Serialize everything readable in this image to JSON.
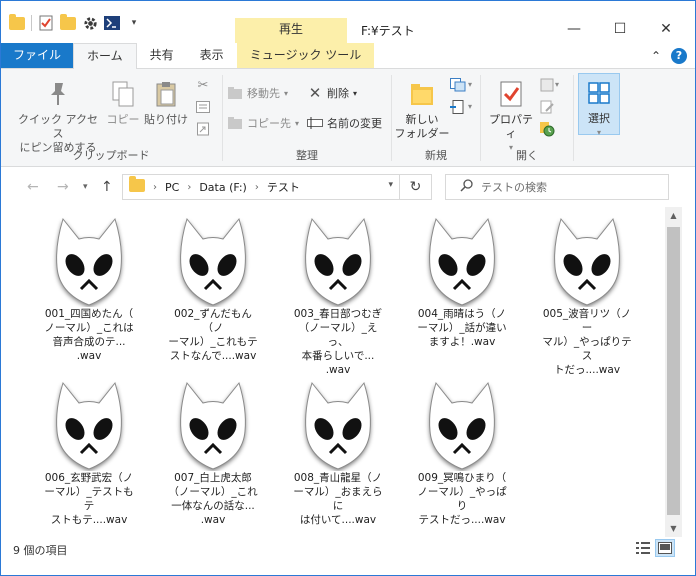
{
  "window": {
    "title": "F:¥テスト",
    "context_tab_header": "再生",
    "minimize_glyph": "—",
    "maximize_glyph": "☐",
    "close_glyph": "✕"
  },
  "tabs": {
    "file": "ファイル",
    "home": "ホーム",
    "share": "共有",
    "view": "表示",
    "music_tools": "ミュージック ツール",
    "collapse_glyph": "⌃",
    "help_glyph": "?"
  },
  "ribbon": {
    "clipboard": {
      "label": "クリップボード",
      "pin_line1": "クイック アクセス",
      "pin_line2": "にピン留めする",
      "copy": "コピー",
      "paste": "貼り付け"
    },
    "organize": {
      "label": "整理",
      "move_to": "移動先",
      "copy_to": "コピー先",
      "delete": "削除",
      "rename": "名前の変更"
    },
    "new": {
      "label": "新規",
      "new_folder_line1": "新しい",
      "new_folder_line2": "フォルダー"
    },
    "open": {
      "label": "開く",
      "properties": "プロパティ"
    },
    "select": {
      "select": "選択"
    }
  },
  "address": {
    "crumbs": [
      "PC",
      "Data (F:)",
      "テスト"
    ],
    "search_placeholder": "テストの検索"
  },
  "files": [
    {
      "line1": "001_四国めたん（",
      "line2": "ノーマル）_これは",
      "line3": "音声合成のテ...",
      "line4": ".wav"
    },
    {
      "line1": "002_ずんだもん（ノ",
      "line2": "ーマル）_これもテ",
      "line3": "ストなんで....wav",
      "line4": ""
    },
    {
      "line1": "003_春日部つむぎ",
      "line2": "（ノーマル）_えっ、",
      "line3": "本番らしいで...",
      "line4": ".wav"
    },
    {
      "line1": "004_雨晴はう（ノ",
      "line2": "ーマル）_話が違い",
      "line3": "ますよ！.wav",
      "line4": ""
    },
    {
      "line1": "005_波音リツ（ノー",
      "line2": "マル）_やっぱりテス",
      "line3": "トだっ....wav",
      "line4": ""
    },
    {
      "line1": "006_玄野武宏（ノ",
      "line2": "ーマル）_テストもテ",
      "line3": "ストもテ....wav",
      "line4": ""
    },
    {
      "line1": "007_白上虎太郎",
      "line2": "（ノーマル）_これ",
      "line3": "一体なんの話な...",
      "line4": ".wav"
    },
    {
      "line1": "008_青山龍星（ノ",
      "line2": "ーマル）_おまえらに",
      "line3": "は付いて....wav",
      "line4": ""
    },
    {
      "line1": "009_冥鳴ひまり（",
      "line2": "ノーマル）_やっぱり",
      "line3": "テストだっ....wav",
      "line4": ""
    }
  ],
  "status": {
    "item_count": "9 個の項目"
  },
  "colors": {
    "accent": "#1979ca",
    "context_tab": "#fcefaa",
    "selected": "#cce4f7",
    "folder": "#f6c64a"
  }
}
